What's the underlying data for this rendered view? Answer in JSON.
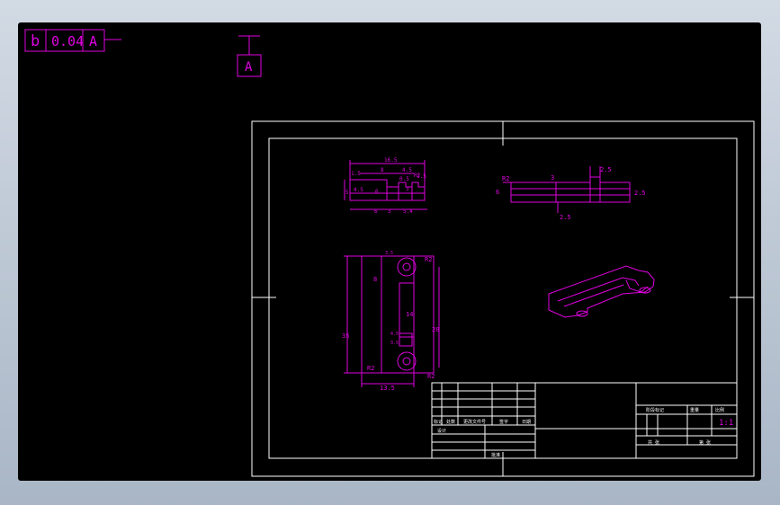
{
  "drawing": {
    "feature_control_frame": {
      "symbol": "b",
      "tolerance": "0.04",
      "datum": "A"
    },
    "datum_flag": {
      "letter": "A"
    },
    "top_view": {
      "dims": [
        "16.5",
        "1.5",
        "8",
        "4.5",
        "0.5",
        "1.5",
        "5",
        "4.5",
        "6",
        "3",
        "6",
        "3",
        "5.4",
        "R2"
      ]
    },
    "side_view": {
      "dims": [
        "R2",
        "3",
        "2.5",
        "6",
        "2.5",
        "2.5"
      ]
    },
    "front_view": {
      "dims": [
        "3.5",
        "R2",
        "8",
        "14",
        "35",
        "28",
        "R2",
        "R2",
        "13.5",
        "4.5",
        "3.5"
      ]
    },
    "title_block": {
      "col_labels": [
        "标记",
        "处数",
        "更改文件号",
        "签字",
        "日期"
      ],
      "row_label_design": "设计",
      "row_label_approve": "批准",
      "right_labels": [
        "阶段标记",
        "重量",
        "比例"
      ],
      "scale": "1:1",
      "sheet_labels": [
        "共 张",
        "第 张"
      ]
    }
  }
}
